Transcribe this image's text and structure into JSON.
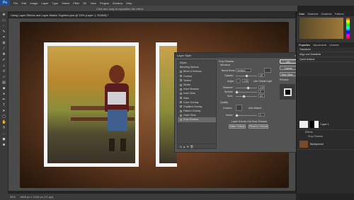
{
  "app": {
    "logo": "Ps"
  },
  "menu": [
    "File",
    "Edit",
    "Image",
    "Layer",
    "Type",
    "Select",
    "Filter",
    "3D",
    "View",
    "Plugins",
    "Window",
    "Help"
  ],
  "options_bar": {
    "hint": "Click and drag to reposition the effect."
  },
  "document_tab": "Using Layer Effects and Layer Masks Together.psd @ 33% (Layer 1, RGB/8) *",
  "status_bar": {
    "zoom": "33%",
    "doc": "1859 px x 1240 px (72 ppi)"
  },
  "dialog": {
    "title": "Layer Style",
    "close": "×",
    "style_list": [
      {
        "label": "Styles",
        "checkbox": false,
        "selected": false
      },
      {
        "label": "Blending Options",
        "checkbox": false,
        "selected": false
      },
      {
        "label": "Bevel & Emboss",
        "checkbox": true,
        "selected": false
      },
      {
        "label": "Contour",
        "checkbox": true,
        "selected": false
      },
      {
        "label": "Texture",
        "checkbox": true,
        "selected": false
      },
      {
        "label": "Stroke",
        "checkbox": true,
        "selected": false
      },
      {
        "label": "Inner Shadow",
        "checkbox": true,
        "selected": false
      },
      {
        "label": "Inner Glow",
        "checkbox": true,
        "selected": false
      },
      {
        "label": "Satin",
        "checkbox": true,
        "selected": false
      },
      {
        "label": "Color Overlay",
        "checkbox": true,
        "selected": false
      },
      {
        "label": "Gradient Overlay",
        "checkbox": true,
        "selected": false
      },
      {
        "label": "Pattern Overlay",
        "checkbox": true,
        "selected": false
      },
      {
        "label": "Outer Glow",
        "checkbox": true,
        "selected": false
      },
      {
        "label": "Drop Shadow",
        "checkbox": true,
        "selected": true
      }
    ],
    "list_footer": "fx  ▲  ▼  🗑",
    "section_title": "Drop Shadow",
    "subsection": "Structure",
    "blend_mode_label": "Blend Mode:",
    "blend_mode_value": "Multiply",
    "opacity_label": "Opacity:",
    "opacity_value": "45",
    "angle_label": "Angle:",
    "angle_value": "135",
    "global_light_label": "Use Global Light",
    "distance_label": "Distance:",
    "distance_value": "100",
    "spread_label": "Spread:",
    "spread_value": "0",
    "size_label": "Size:",
    "size_value": "63",
    "quality_label": "Quality",
    "contour_label": "Contour:",
    "antialiased_label": "Anti-aliased",
    "noise_label": "Noise:",
    "noise_value": "0",
    "knockout_label": "Layer Knocks Out Drop Shadow",
    "make_default": "Make Default",
    "reset_default": "Reset to Default",
    "buttons": [
      "OK",
      "Cancel",
      "New Style...",
      "Preview"
    ],
    "shadow_color": "#000000"
  },
  "right_panel": {
    "color_tabs": [
      "Color",
      "Swatches",
      "Gradients",
      "Patterns"
    ],
    "prop_tabs": [
      "Properties",
      "Adjustments",
      "Libraries"
    ],
    "prop_sections": [
      "Transform",
      "Align and Distribute",
      "Quick Actions"
    ],
    "layers": [
      {
        "name": "Layer 1",
        "type": "photo"
      },
      {
        "name": "Effects",
        "type": "fx"
      },
      {
        "name": "Drop Shadow",
        "type": "fx"
      },
      {
        "name": "Background",
        "type": "wood"
      }
    ]
  }
}
